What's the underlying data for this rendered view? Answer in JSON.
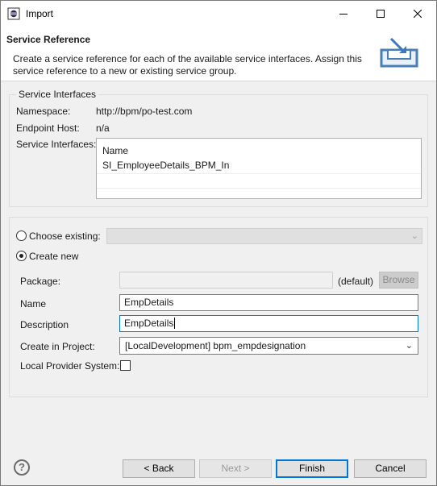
{
  "window": {
    "title": "Import",
    "min_icon": "minimize-icon",
    "max_icon": "maximize-icon",
    "close_icon": "close-icon"
  },
  "header": {
    "title": "Service Reference",
    "description": "Create a service reference for each of the available service interfaces. Assign this service reference to a new or existing service group."
  },
  "service_interfaces": {
    "legend": "Service Interfaces",
    "namespace_label": "Namespace:",
    "namespace_value": "http://bpm/po-test.com",
    "endpoint_label": "Endpoint Host:",
    "endpoint_value": "n/a",
    "interfaces_label": "Service Interfaces:",
    "list_header": "Name",
    "items": [
      "SI_EmployeeDetails_BPM_In"
    ]
  },
  "group": {
    "choose_existing_label": "Choose existing:",
    "create_new_label": "Create new",
    "selected": "create_new",
    "existing_value": ""
  },
  "form": {
    "package_label": "Package:",
    "package_value": "",
    "package_default": "(default)",
    "browse_label": "Browse",
    "name_label": "Name",
    "name_value": "EmpDetails",
    "description_label": "Description",
    "description_value": "EmpDetails",
    "project_label": "Create in Project:",
    "project_value": "[LocalDevelopment] bpm_empdesignation",
    "local_provider_label": "Local Provider System:",
    "local_provider_checked": false
  },
  "buttons": {
    "back": "< Back",
    "next": "Next >",
    "finish": "Finish",
    "cancel": "Cancel"
  }
}
